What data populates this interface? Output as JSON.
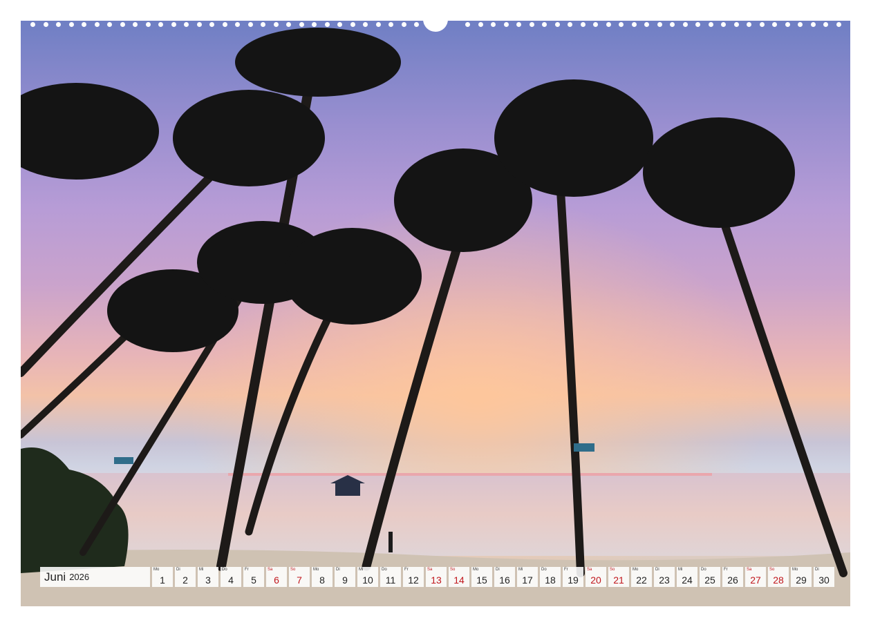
{
  "calendar": {
    "month": "Juni",
    "year": "2026",
    "weekend_color": "#c0161c",
    "days": [
      {
        "wd": "Mo",
        "d": "1",
        "we": false
      },
      {
        "wd": "Di",
        "d": "2",
        "we": false
      },
      {
        "wd": "Mi",
        "d": "3",
        "we": false
      },
      {
        "wd": "Do",
        "d": "4",
        "we": false
      },
      {
        "wd": "Fr",
        "d": "5",
        "we": false
      },
      {
        "wd": "Sa",
        "d": "6",
        "we": true
      },
      {
        "wd": "So",
        "d": "7",
        "we": true
      },
      {
        "wd": "Mo",
        "d": "8",
        "we": false
      },
      {
        "wd": "Di",
        "d": "9",
        "we": false
      },
      {
        "wd": "Mi",
        "d": "10",
        "we": false
      },
      {
        "wd": "Do",
        "d": "11",
        "we": false
      },
      {
        "wd": "Fr",
        "d": "12",
        "we": false
      },
      {
        "wd": "Sa",
        "d": "13",
        "we": true
      },
      {
        "wd": "So",
        "d": "14",
        "we": true
      },
      {
        "wd": "Mo",
        "d": "15",
        "we": false
      },
      {
        "wd": "Di",
        "d": "16",
        "we": false
      },
      {
        "wd": "Mi",
        "d": "17",
        "we": false
      },
      {
        "wd": "Do",
        "d": "18",
        "we": false
      },
      {
        "wd": "Fr",
        "d": "19",
        "we": false
      },
      {
        "wd": "Sa",
        "d": "20",
        "we": true
      },
      {
        "wd": "So",
        "d": "21",
        "we": true
      },
      {
        "wd": "Mo",
        "d": "22",
        "we": false
      },
      {
        "wd": "Di",
        "d": "23",
        "we": false
      },
      {
        "wd": "Mi",
        "d": "24",
        "we": false
      },
      {
        "wd": "Do",
        "d": "25",
        "we": false
      },
      {
        "wd": "Fr",
        "d": "26",
        "we": false
      },
      {
        "wd": "Sa",
        "d": "27",
        "we": true
      },
      {
        "wd": "So",
        "d": "28",
        "we": true
      },
      {
        "wd": "Mo",
        "d": "29",
        "we": false
      },
      {
        "wd": "Di",
        "d": "30",
        "we": false
      }
    ]
  }
}
